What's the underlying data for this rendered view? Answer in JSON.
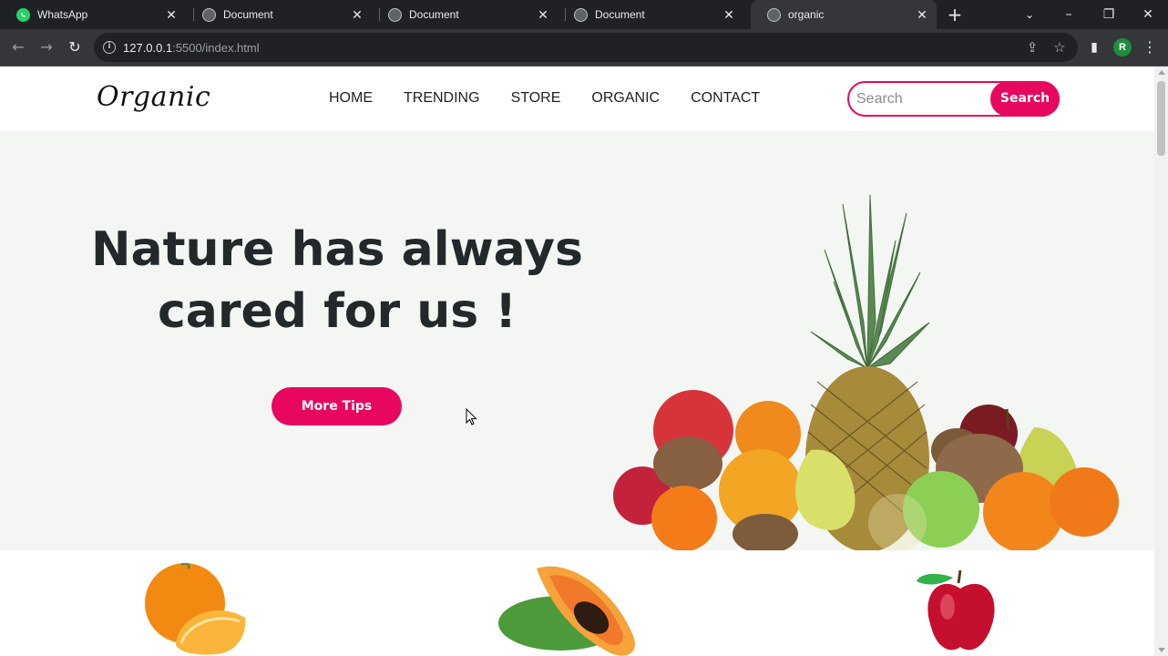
{
  "browser": {
    "tabs": [
      {
        "title": "WhatsApp",
        "icon": "whatsapp-icon",
        "active": false
      },
      {
        "title": "Document",
        "icon": "globe-icon",
        "active": false
      },
      {
        "title": "Document",
        "icon": "globe-icon",
        "active": false
      },
      {
        "title": "Document",
        "icon": "globe-icon",
        "active": false
      },
      {
        "title": "organic",
        "icon": "globe-icon",
        "active": true
      }
    ],
    "url_host": "127.0.0.1",
    "url_rest": ":5500/index.html",
    "profile_initial": "R"
  },
  "site": {
    "logo": "Organic",
    "nav": [
      "HOME",
      "TRENDING",
      "STORE",
      "ORGANIC",
      "CONTACT"
    ],
    "search_placeholder": "Search",
    "search_button": "Search"
  },
  "hero": {
    "title_line1": "Nature has always",
    "title_line2": "cared for us !",
    "button": "More Tips"
  },
  "colors": {
    "accent": "#e8075e",
    "hero_bg": "#f3f6f2",
    "heading": "#23282b"
  }
}
